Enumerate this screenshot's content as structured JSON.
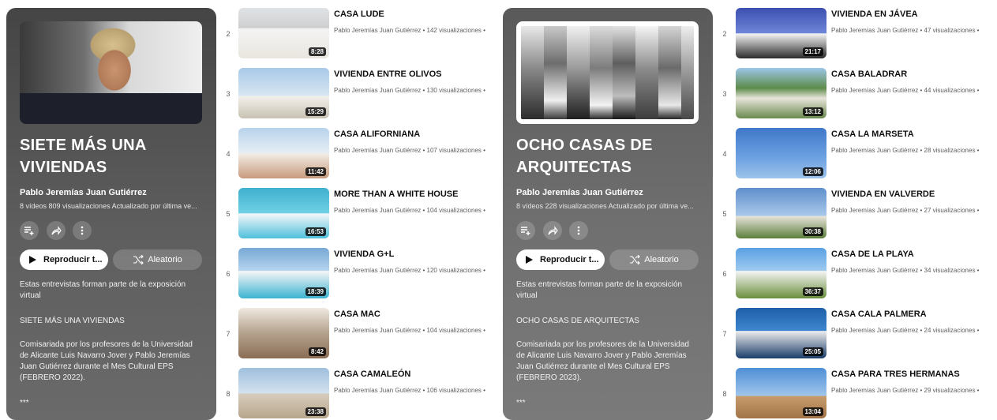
{
  "panels": [
    {
      "title_line1": "SIETE MÁS UNA",
      "title_line2": "VIVIENDAS",
      "owner": "Pablo Jeremías Juan Gutiérrez",
      "meta": "8 vídeos  809 visualizaciones  Actualizado por última ve...",
      "play_label": "Reproducir t...",
      "shuffle_label": "Aleatorio",
      "desc_1": "Estas entrevistas forman parte de la exposición virtual",
      "desc_2": "SIETE MÁS UNA VIVIENDAS",
      "desc_3": "Comisariada por los profesores de la Universidad de Alicante Luis Navarro Jover y Pablo Jeremías Juan Gutiérrez durante el Mes Cultural EPS (FEBRERO 2022).",
      "desc_4": "***"
    },
    {
      "title_line1": "OCHO CASAS DE",
      "title_line2": "ARQUITECTAS",
      "owner": "Pablo Jeremías Juan Gutiérrez",
      "meta": "8 vídeos  228 visualizaciones  Actualizado por última ve...",
      "play_label": "Reproducir t...",
      "shuffle_label": "Aleatorio",
      "desc_1": "Estas entrevistas forman parte de la exposición virtual",
      "desc_2": "OCHO CASAS DE ARQUITECTAS",
      "desc_3": "Comisariada por los profesores de la Universidad de Alicante Luis Navarro Jover y Pablo Jeremías Juan Gutiérrez durante el Mes Cultural EPS (FEBRERO 2023).",
      "desc_4": "***"
    }
  ],
  "videos_a": [
    {
      "index": "2",
      "title": "CASA LUDE",
      "meta": "Pablo Jeremías Juan Gutiérrez • 142 visualizaciones •",
      "duration": "8:28"
    },
    {
      "index": "3",
      "title": "VIVIENDA ENTRE OLIVOS",
      "meta": "Pablo Jeremías Juan Gutiérrez • 130 visualizaciones •",
      "duration": "15:29"
    },
    {
      "index": "4",
      "title": "CASA ALIFORNIANA",
      "meta": "Pablo Jeremías Juan Gutiérrez • 107 visualizaciones •",
      "duration": "11:42"
    },
    {
      "index": "5",
      "title": "MORE THAN A WHITE HOUSE",
      "meta": "Pablo Jeremías Juan Gutiérrez • 104 visualizaciones •",
      "duration": "16:53"
    },
    {
      "index": "6",
      "title": "VIVIENDA G+L",
      "meta": "Pablo Jeremías Juan Gutiérrez • 120 visualizaciones •",
      "duration": "18:39"
    },
    {
      "index": "7",
      "title": "CASA MAC",
      "meta": "Pablo Jeremías Juan Gutiérrez • 104 visualizaciones •",
      "duration": "8:42"
    },
    {
      "index": "8",
      "title": "CASA CAMALEÓN",
      "meta": "Pablo Jeremías Juan Gutiérrez • 106 visualizaciones •",
      "duration": "23:38"
    }
  ],
  "videos_b": [
    {
      "index": "2",
      "title": "VIVIENDA EN JÁVEA",
      "meta": "Pablo Jeremías Juan Gutiérrez • 47 visualizaciones •",
      "duration": "21:17"
    },
    {
      "index": "3",
      "title": "CASA BALADRAR",
      "meta": "Pablo Jeremías Juan Gutiérrez • 44 visualizaciones •",
      "duration": "13:12"
    },
    {
      "index": "4",
      "title": "CASA LA MARSETA",
      "meta": "Pablo Jeremías Juan Gutiérrez • 28 visualizaciones •",
      "duration": "12:06"
    },
    {
      "index": "5",
      "title": "VIVIENDA EN VALVERDE",
      "meta": "Pablo Jeremías Juan Gutiérrez • 27 visualizaciones •",
      "duration": "30:38"
    },
    {
      "index": "6",
      "title": "CASA DE LA PLAYA",
      "meta": "Pablo Jeremías Juan Gutiérrez • 34 visualizaciones •",
      "duration": "36:37"
    },
    {
      "index": "7",
      "title": "CASA CALA PALMERA",
      "meta": "Pablo Jeremías Juan Gutiérrez • 24 visualizaciones •",
      "duration": "25:05"
    },
    {
      "index": "8",
      "title": "CASA PARA TRES HERMANAS",
      "meta": "Pablo Jeremías Juan Gutiérrez • 29 visualizaciones •",
      "duration": "13:04"
    }
  ],
  "icons": {
    "add_to_queue": "add-to-queue-icon",
    "share": "share-icon",
    "more": "more-vert-icon",
    "play": "play-icon",
    "shuffle": "shuffle-icon"
  }
}
